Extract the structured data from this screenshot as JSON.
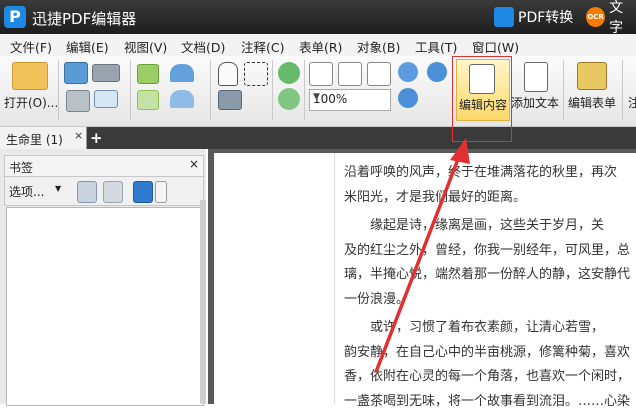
{
  "title_bar": {
    "app_name": "迅捷PDF编辑器",
    "logo_letter": "P",
    "pdf_convert_label": "PDF转换",
    "ocr_badge": "OCR",
    "text_label": "文字"
  },
  "menu": {
    "items": [
      "文件(F)",
      "编辑(E)",
      "视图(V)",
      "文档(D)",
      "注释(C)",
      "表单(R)",
      "对象(B)",
      "工具(T)",
      "窗口(W)"
    ]
  },
  "toolbar": {
    "open_label": "打开(O)...",
    "zoom_value": "100%",
    "edit_content_label": "编辑内容",
    "add_text_label": "添加文本",
    "edit_form_label": "编辑表单",
    "partial_label": "注"
  },
  "tabs": {
    "doc_tab_label": "生命里 (1)",
    "close_symbol": "×",
    "add_symbol": "+"
  },
  "bookmark_panel": {
    "title": "书签",
    "close_symbol": "×",
    "options_label": "选项..."
  },
  "document": {
    "lines": [
      "沿着呼唤的风声，终于在堆满落花的秋里，再次",
      "米阳光，才是我们最好的距离。",
      "　　缘起是诗，缘离是画，这些关于岁月，关",
      "及的红尘之外，曾经，你我一别经年，可风里，总",
      "璃，半掩心悦，端然着那一份醉人的静，这安静代",
      "一份浪漫。",
      "　　或许，习惯了着布衣素颜，让清心若雪，",
      "韵安静，在自己心中的半亩桃源，修篱种菊，喜欢",
      "香，依附在心灵的每一个角落，也喜欢一个闲时，",
      "一盏茶喝到无味，将一个故事看到流泪。……心染"
    ]
  },
  "colors": {
    "title_bg": "#2a2a2a",
    "highlight_fill": "#ffd86b",
    "annotation_red": "#e23030"
  }
}
